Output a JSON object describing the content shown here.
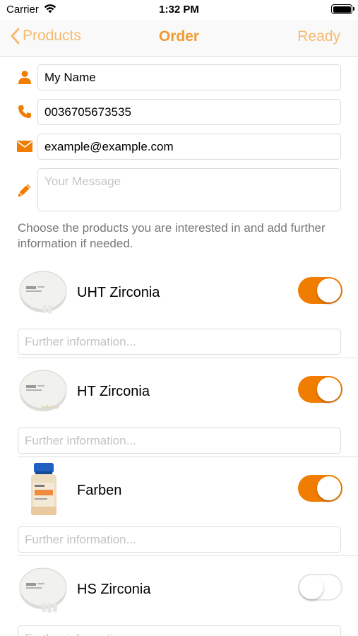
{
  "status_bar": {
    "carrier": "Carrier",
    "time": "1:32 PM",
    "wifi_icon": "wifi-icon",
    "battery_icon": "battery-icon"
  },
  "navbar": {
    "back_label": "Products",
    "title": "Order",
    "ready_label": "Ready",
    "back_icon": "chevron-left-icon"
  },
  "form": {
    "name": {
      "value": "My Name",
      "icon": "person-icon"
    },
    "phone": {
      "value": "0036705673535",
      "icon": "phone-icon"
    },
    "email": {
      "value": "example@example.com",
      "icon": "envelope-icon"
    },
    "message": {
      "placeholder": "Your Message",
      "icon": "pencil-icon"
    }
  },
  "intro_text": "Choose the products you are interested in and add further information if needed.",
  "products": [
    {
      "name": "UHT Zirconia",
      "enabled": true,
      "placeholder": "Further information...",
      "image": "zirconia-disc-image"
    },
    {
      "name": "HT Zirconia",
      "enabled": true,
      "placeholder": "Further information...",
      "image": "zirconia-disc-image"
    },
    {
      "name": "Farben",
      "enabled": true,
      "placeholder": "Further information...",
      "image": "paint-bottle-image"
    },
    {
      "name": "HS Zirconia",
      "enabled": false,
      "placeholder": "Further information...",
      "image": "zirconia-disc-image"
    }
  ],
  "colors": {
    "accent": "#f07d00",
    "nav_title": "#f09a30",
    "nav_button": "#f7ba6e"
  }
}
